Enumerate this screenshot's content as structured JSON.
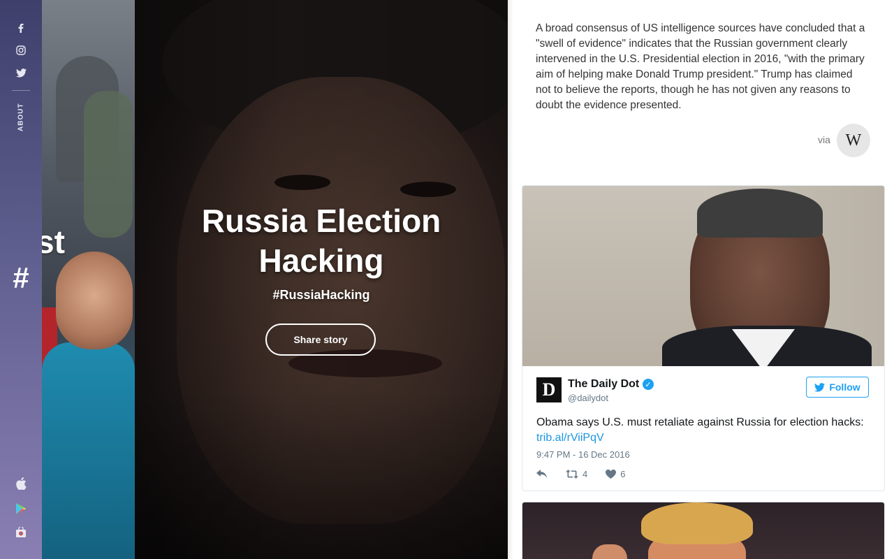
{
  "rail": {
    "social": [
      "facebook-icon",
      "instagram-icon",
      "twitter-icon"
    ],
    "about_label": "ABOUT",
    "hash_symbol": "#",
    "apps": [
      "apple-icon",
      "google-play-icon",
      "chrome-store-icon"
    ]
  },
  "prev_story": {
    "title_fragment": "st"
  },
  "hero": {
    "title": "Russia Election Hacking",
    "hashtag": "#RussiaHacking",
    "share_label": "Share story"
  },
  "summary": {
    "text": "A broad consensus of US intelligence sources have concluded that a \"swell of evidence\" indicates that the Russian government clearly intervened in the U.S. Presidential election in 2016, \"with the primary aim of helping make Donald Trump president.\" Trump has claimed not to believe the reports, though he has not given any reasons to doubt the evidence presented.",
    "via_label": "via",
    "source_logo": "W"
  },
  "tweet": {
    "avatar_letter": "D",
    "author_name": "The Daily Dot",
    "handle": "@dailydot",
    "follow_label": "Follow",
    "text": "Obama says U.S. must retaliate against Russia for election hacks: ",
    "link": "trib.al/rViiPqV",
    "timestamp": "9:47 PM - 16 Dec 2016",
    "retweets": "4",
    "likes": "6"
  },
  "colors": {
    "twitter_blue": "#1da1f2",
    "link_blue": "#1b95e0",
    "rail_top": "#3e3f6b",
    "rail_bottom": "#8a7fb3"
  }
}
